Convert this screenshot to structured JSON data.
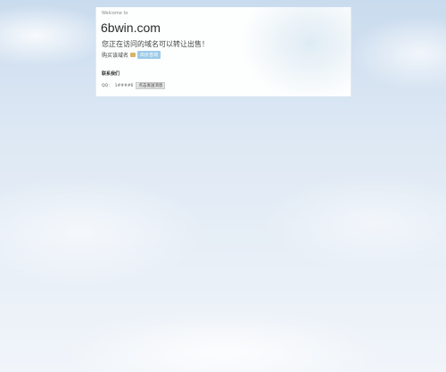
{
  "header": {
    "welcome": "Welcome to"
  },
  "domain": "6bwin.com",
  "notice": "您正在访问的域名可以转让出售！",
  "buy": {
    "label": "购买该域名",
    "button": "出价咨询"
  },
  "contact": {
    "title": "联系我们",
    "qq_label": "QQ：",
    "qq_value": "1####6",
    "button": "点击发送消息"
  }
}
